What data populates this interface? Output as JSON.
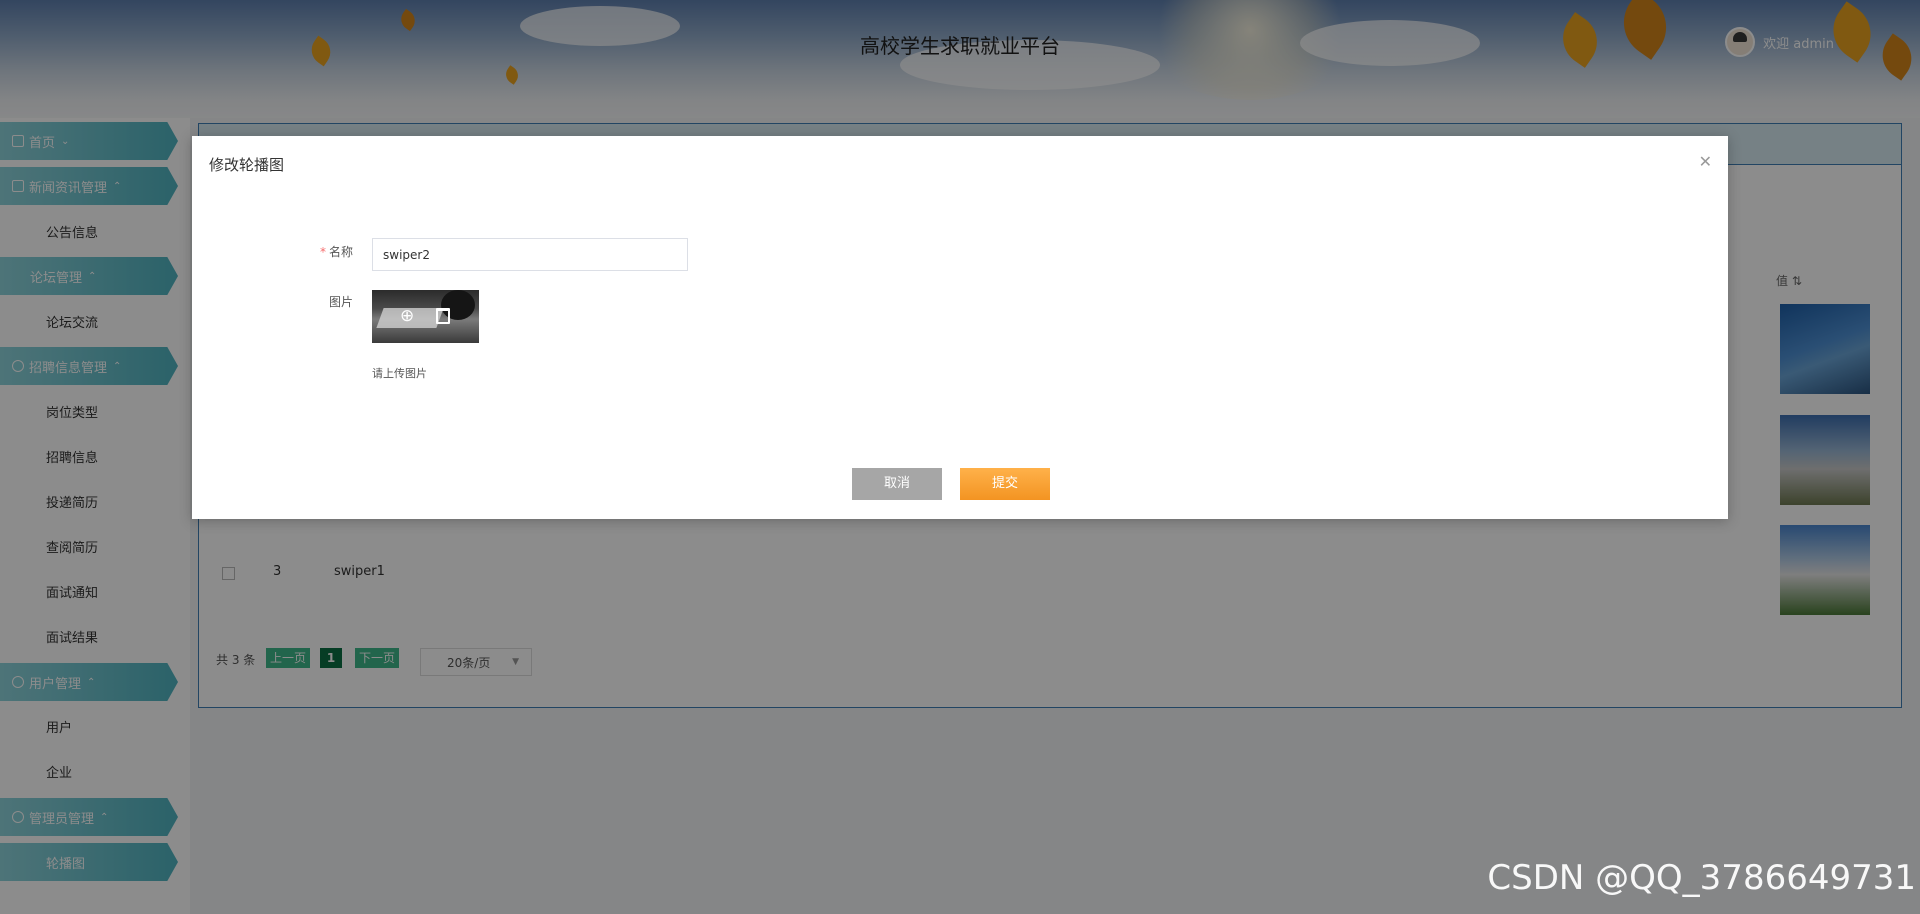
{
  "header": {
    "title": "高校学生求职就业平台",
    "welcome": "欢迎 admin"
  },
  "sidebar": {
    "groups": [
      {
        "label": "首页",
        "items": []
      },
      {
        "label": "新闻资讯管理",
        "items": [
          "公告信息"
        ]
      },
      {
        "label": "论坛管理",
        "items": [
          "论坛交流"
        ]
      },
      {
        "label": "招聘信息管理",
        "items": [
          "岗位类型",
          "招聘信息",
          "投递简历",
          "查阅简历",
          "面试通知",
          "面试结果"
        ]
      },
      {
        "label": "用户管理",
        "items": [
          "用户",
          "企业"
        ]
      },
      {
        "label": "管理员管理",
        "items": [
          "轮播图"
        ]
      }
    ],
    "active": "轮播图"
  },
  "table": {
    "value_header": "值",
    "rows": [
      {
        "index": "3",
        "name": "swiper1"
      }
    ]
  },
  "pagination": {
    "total": "共 3 条",
    "prev": "上一页",
    "current": "1",
    "next": "下一页",
    "page_size": "20条/页"
  },
  "modal": {
    "title": "修改轮播图",
    "name_label": "名称",
    "name_value": "swiper2",
    "image_label": "图片",
    "upload_hint": "请上传图片",
    "cancel": "取消",
    "submit": "提交"
  },
  "watermark": "CSDN @QQ_3786649731"
}
